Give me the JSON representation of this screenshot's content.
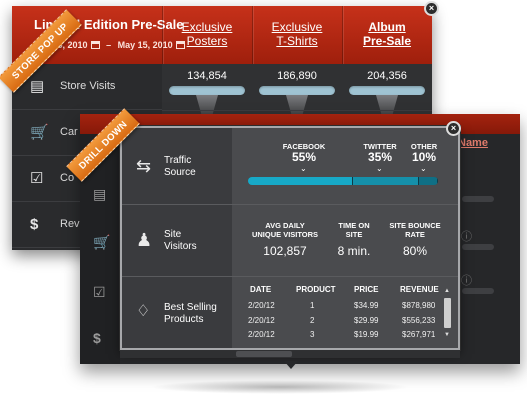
{
  "store_popup": {
    "ribbon": "STORE POP UP",
    "title": "Limited Edition Pre-Sale",
    "date_start": "Mar 15, 2010",
    "date_sep": "–",
    "date_end": "May 15, 2010",
    "tabs": [
      {
        "line1": "Exclusive",
        "line2": "Posters"
      },
      {
        "line1": "Exclusive",
        "line2": "T-Shirts"
      },
      {
        "line1": "Album",
        "line2": "Pre-Sale"
      }
    ],
    "rows": [
      {
        "label": "Store Visits",
        "icon": "storefront-icon"
      },
      {
        "label": "Car",
        "icon": "cart-icon"
      },
      {
        "label": "Co",
        "icon": "checkbox-icon"
      },
      {
        "label": "Rev",
        "icon": "dollar-icon"
      }
    ],
    "store_visits": [
      "134,854",
      "186,890",
      "204,356"
    ],
    "name_link": "Name",
    "close": "×"
  },
  "drill_down": {
    "ribbon": "DRILL DOWN",
    "close": "×",
    "traffic_source": {
      "label_line1": "Traffic",
      "label_line2": "Source",
      "sources": [
        {
          "name": "FACEBOOK",
          "value": "55%",
          "fraction": 0.55,
          "color": "#17a9c7"
        },
        {
          "name": "TWITTER",
          "value": "35%",
          "fraction": 0.35,
          "color": "#1590aa"
        },
        {
          "name": "OTHER",
          "value": "10%",
          "fraction": 0.1,
          "color": "#0f6f85"
        }
      ]
    },
    "site_visitors": {
      "label_line1": "Site",
      "label_line2": "Visitors",
      "stats": [
        {
          "h1": "AVG DAILY",
          "h2": "UNIQUE VISITORS",
          "value": "102,857"
        },
        {
          "h1": "TIME ON",
          "h2": "SITE",
          "value": "8 min."
        },
        {
          "h1": "SITE BOUNCE",
          "h2": "RATE",
          "value": "80%"
        }
      ]
    },
    "best_selling": {
      "label_line1": "Best Selling",
      "label_line2": "Products",
      "columns": [
        "DATE",
        "PRODUCT",
        "PRICE",
        "REVENUE"
      ],
      "rows": [
        [
          "2/20/12",
          "1",
          "$34.99",
          "$878,980"
        ],
        [
          "2/20/12",
          "2",
          "$29.99",
          "$556,233"
        ],
        [
          "2/20/12",
          "3",
          "$19.99",
          "$267,971"
        ]
      ]
    }
  }
}
